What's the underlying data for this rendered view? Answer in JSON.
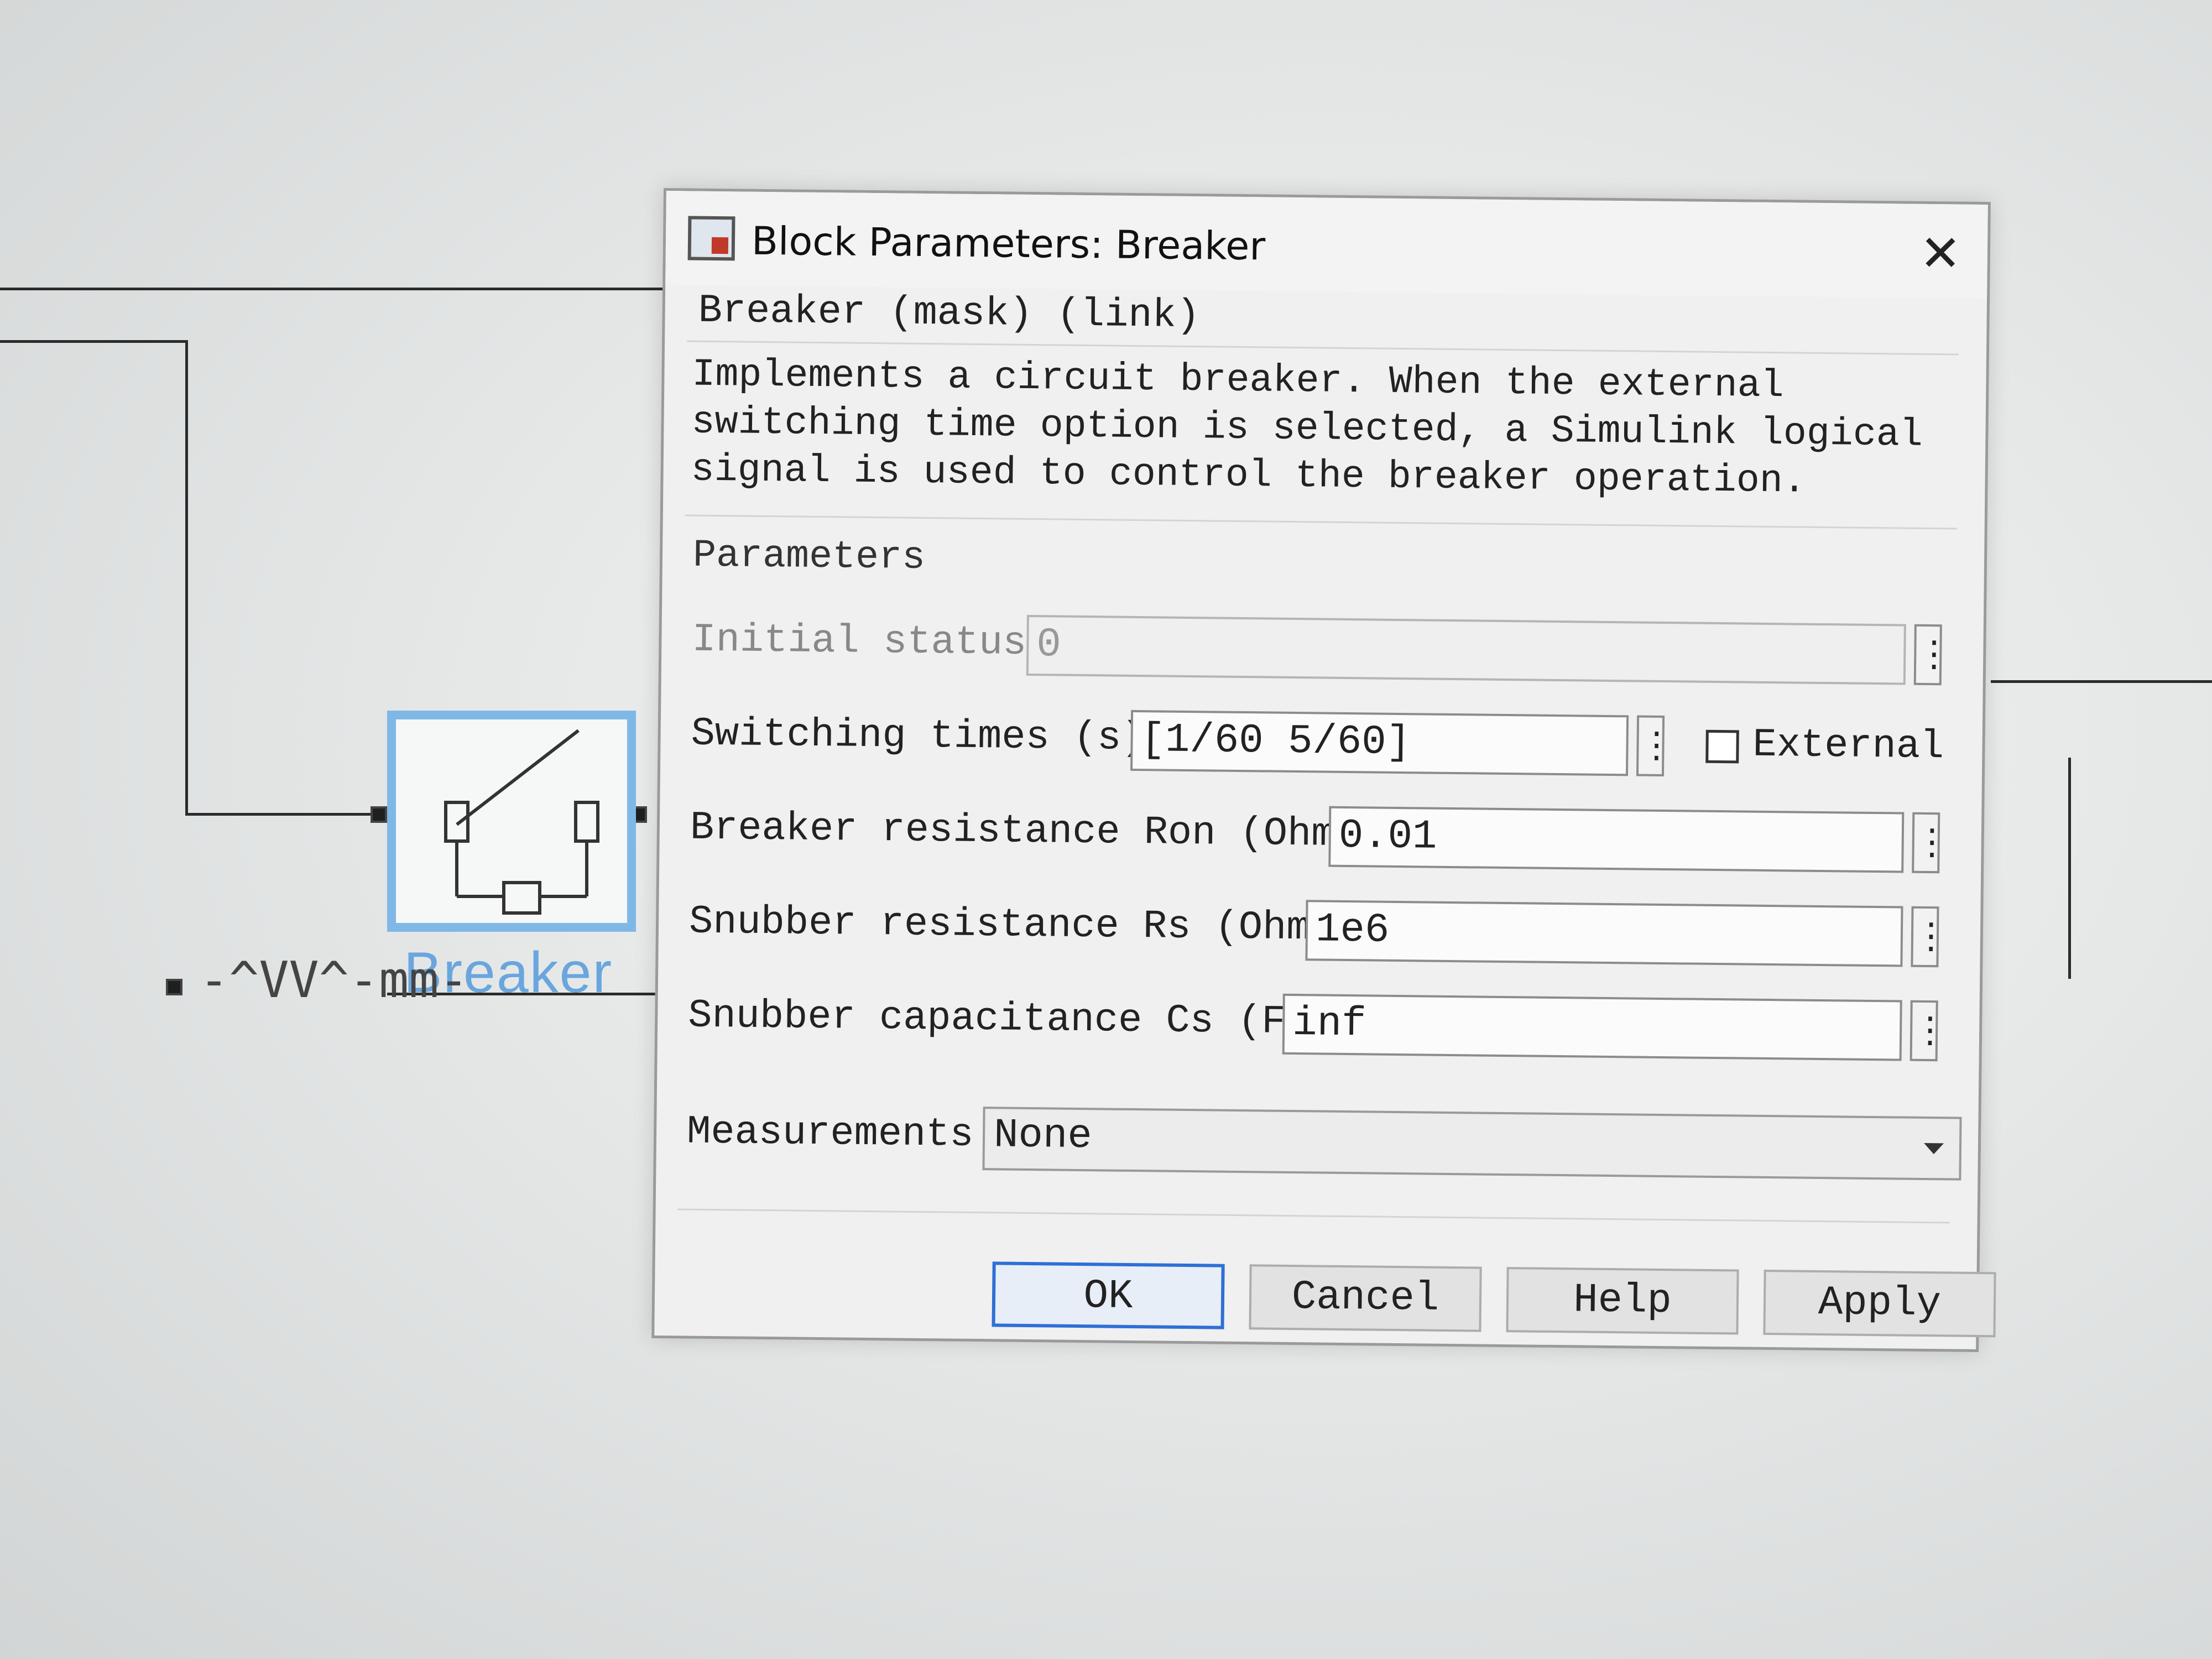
{
  "canvas": {
    "block_label": "Breaker",
    "rlc_glyph": "-^VV^-mm-"
  },
  "dialog": {
    "title": "Block Parameters: Breaker",
    "close_glyph": "✕",
    "subtitle": "Breaker (mask) (link)",
    "description": "Implements a circuit breaker. When the external switching time option is selected, a Simulink logical signal is used to control the breaker operation.",
    "group_title": "Parameters",
    "params": {
      "initial_status": {
        "label": "Initial status:",
        "value": "0"
      },
      "switching_times": {
        "label": "Switching times (s):",
        "value": "[1/60  5/60]"
      },
      "external": {
        "label": "External",
        "checked": false
      },
      "ron": {
        "label": "Breaker resistance Ron (Ohm):",
        "value": "0.01"
      },
      "rs": {
        "label": "Snubber resistance Rs (Ohm):",
        "value": "1e6"
      },
      "cs": {
        "label": "Snubber capacitance Cs (F):",
        "value": "inf"
      },
      "measurements": {
        "label": "Measurements",
        "value": "None"
      }
    },
    "kebab_glyph": "⋮",
    "buttons": {
      "ok": "OK",
      "cancel": "Cancel",
      "help": "Help",
      "apply": "Apply"
    }
  },
  "colors": {
    "accent": "#2f6fd6",
    "block_highlight": "#7fb8e6"
  }
}
